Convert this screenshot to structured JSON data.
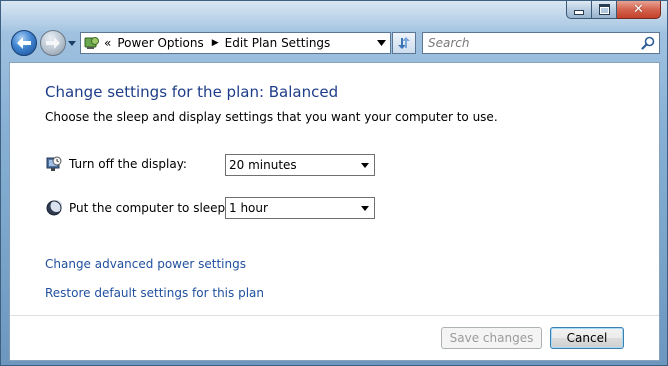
{
  "window": {
    "caption_buttons": [
      "minimize-icon",
      "maximize-icon",
      "close-icon"
    ]
  },
  "navigation": {
    "back_icon": "back-arrow-icon",
    "forward_icon": "forward-arrow-icon",
    "history_icon": "chevron-down-icon"
  },
  "address": {
    "overflow": "«",
    "breadcrumbs": [
      {
        "label": "Power Options"
      },
      {
        "label": "Edit Plan Settings"
      }
    ],
    "refresh_icon": "refresh-icon"
  },
  "search": {
    "placeholder": "Search",
    "value": ""
  },
  "main": {
    "title": "Change settings for the plan: Balanced",
    "subtitle": "Choose the sleep and display settings that you want your computer to use.",
    "settings": [
      {
        "icon": "display-clock-icon",
        "label": "Turn off the display:",
        "value": "20 minutes"
      },
      {
        "icon": "sleep-moon-icon",
        "label": "Put the computer to sleep:",
        "value": "1 hour"
      }
    ],
    "links": [
      {
        "label": "Change advanced power settings"
      },
      {
        "label": "Restore default settings for this plan"
      }
    ]
  },
  "footer": {
    "save_label": "Save changes",
    "save_enabled": false,
    "cancel_label": "Cancel"
  },
  "colors": {
    "title": "#1e3d8a",
    "link": "#1f4f9e",
    "close_button": "#c3412a"
  }
}
